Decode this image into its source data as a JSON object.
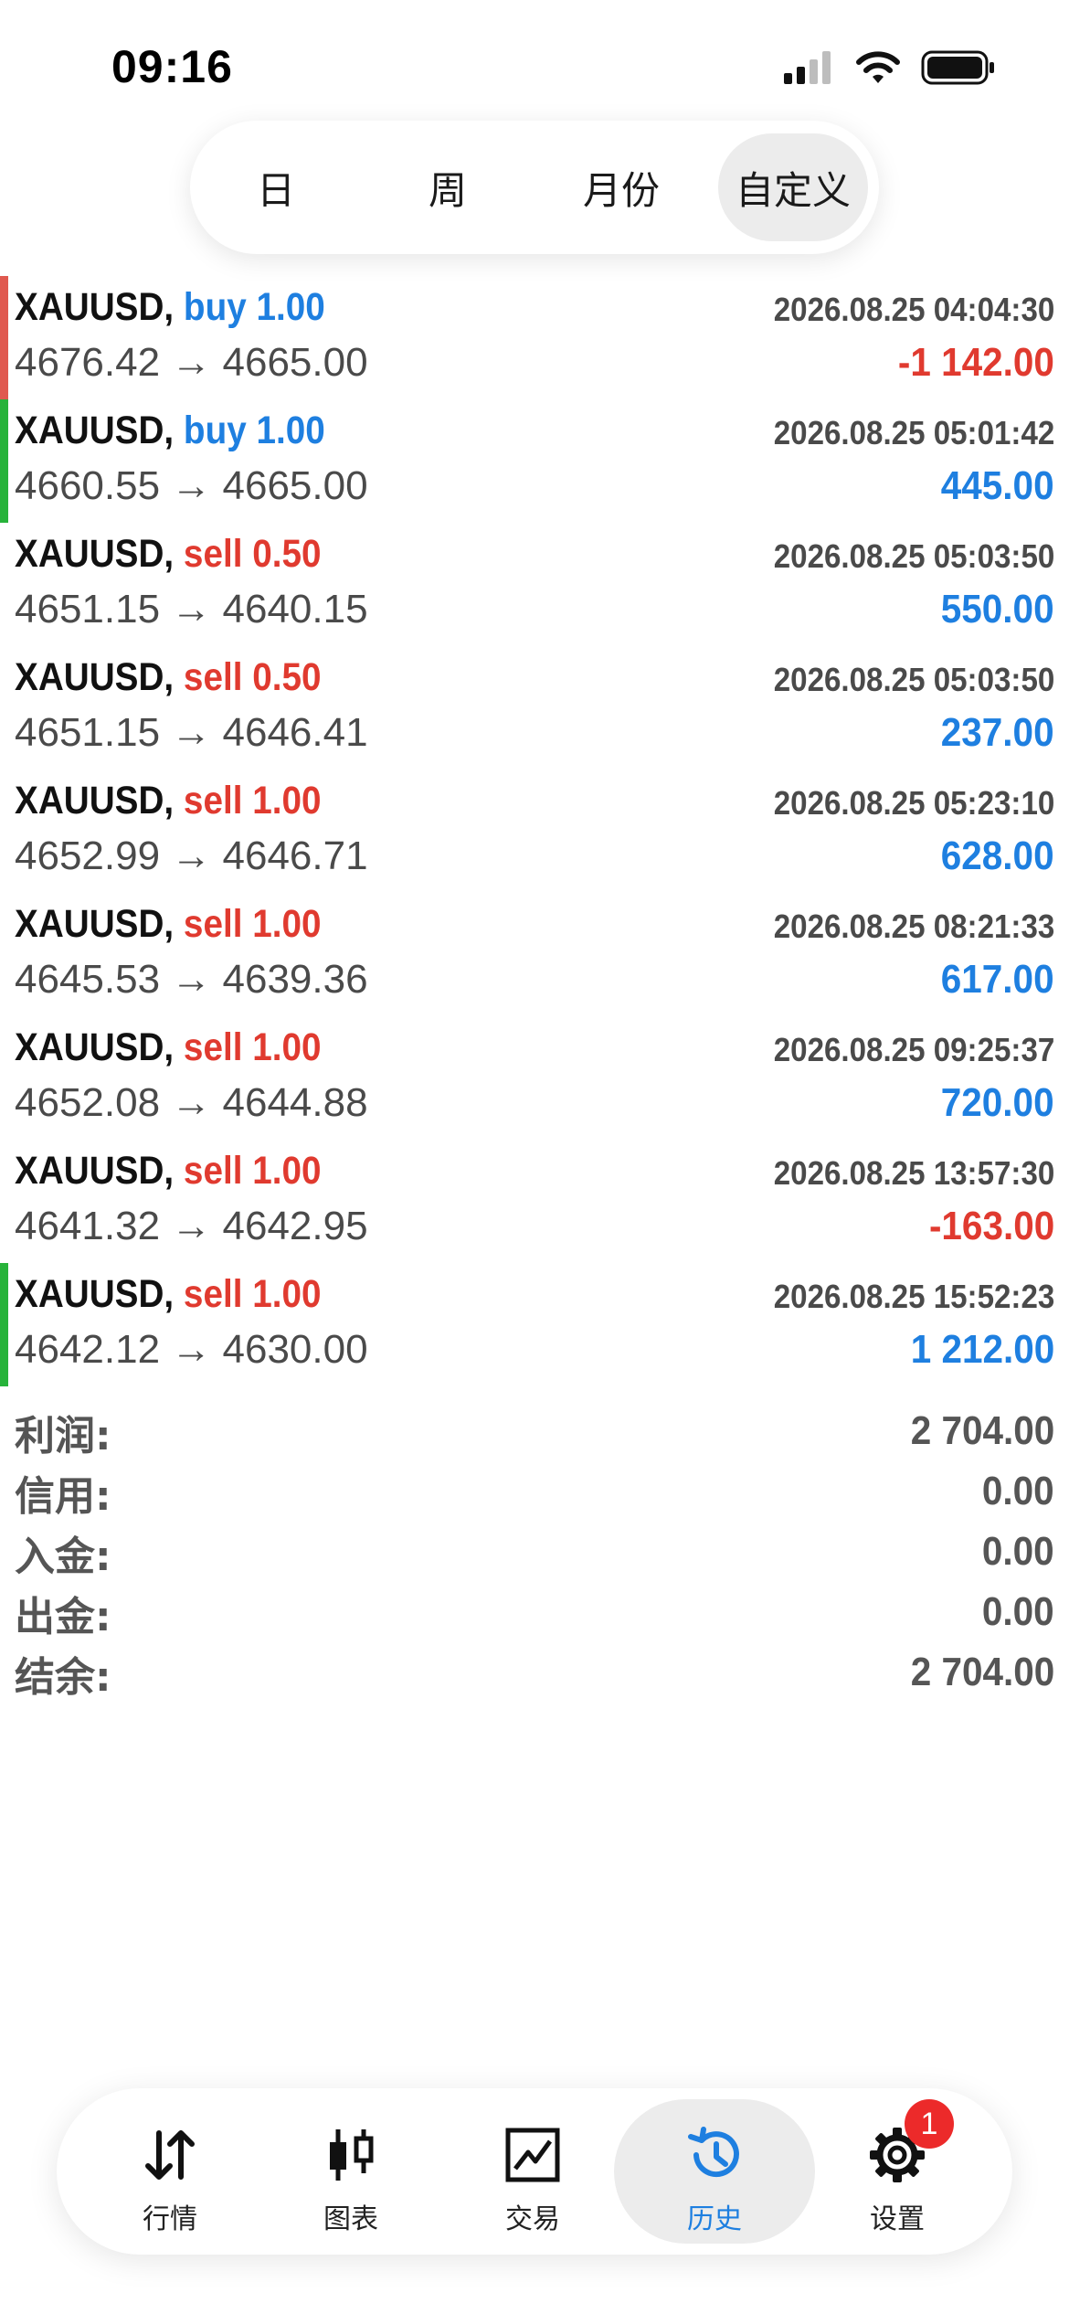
{
  "status_bar": {
    "time": "09:16",
    "icons": [
      "cellular-signal-icon",
      "wifi-icon",
      "battery-icon"
    ]
  },
  "period_tabs": [
    {
      "label": "日",
      "active": false
    },
    {
      "label": "周",
      "active": false
    },
    {
      "label": "月份",
      "active": false
    },
    {
      "label": "自定义",
      "active": true
    }
  ],
  "trades": [
    {
      "symbol": "XAUUSD,",
      "side": "buy 1.00",
      "type": "buy",
      "time": "2026.08.25 04:04:30",
      "prices": "4676.42 → 4665.00",
      "profit": "-1 142.00",
      "accent": "#e0594f"
    },
    {
      "symbol": "XAUUSD,",
      "side": "buy 1.00",
      "type": "buy",
      "time": "2026.08.25 05:01:42",
      "prices": "4660.55 → 4665.00",
      "profit": "445.00",
      "accent": "#27b33a"
    },
    {
      "symbol": "XAUUSD,",
      "side": "sell 0.50",
      "type": "sell",
      "time": "2026.08.25 05:03:50",
      "prices": "4651.15 → 4640.15",
      "profit": "550.00",
      "accent": ""
    },
    {
      "symbol": "XAUUSD,",
      "side": "sell 0.50",
      "type": "sell",
      "time": "2026.08.25 05:03:50",
      "prices": "4651.15 → 4646.41",
      "profit": "237.00",
      "accent": ""
    },
    {
      "symbol": "XAUUSD,",
      "side": "sell 1.00",
      "type": "sell",
      "time": "2026.08.25 05:23:10",
      "prices": "4652.99 → 4646.71",
      "profit": "628.00",
      "accent": ""
    },
    {
      "symbol": "XAUUSD,",
      "side": "sell 1.00",
      "type": "sell",
      "time": "2026.08.25 08:21:33",
      "prices": "4645.53 → 4639.36",
      "profit": "617.00",
      "accent": ""
    },
    {
      "symbol": "XAUUSD,",
      "side": "sell 1.00",
      "type": "sell",
      "time": "2026.08.25 09:25:37",
      "prices": "4652.08 → 4644.88",
      "profit": "720.00",
      "accent": ""
    },
    {
      "symbol": "XAUUSD,",
      "side": "sell 1.00",
      "type": "sell",
      "time": "2026.08.25 13:57:30",
      "prices": "4641.32 → 4642.95",
      "profit": "-163.00",
      "accent": ""
    },
    {
      "symbol": "XAUUSD,",
      "side": "sell 1.00",
      "type": "sell",
      "time": "2026.08.25 15:52:23",
      "prices": "4642.12 → 4630.00",
      "profit": "1 212.00",
      "accent": "#27b33a"
    }
  ],
  "summary": [
    {
      "label": "利润:",
      "value": "2 704.00"
    },
    {
      "label": "信用:",
      "value": "0.00"
    },
    {
      "label": "入金:",
      "value": "0.00"
    },
    {
      "label": "出金:",
      "value": "0.00"
    },
    {
      "label": "结余:",
      "value": "2 704.00"
    }
  ],
  "bottom_nav": [
    {
      "label": "行情",
      "icon": "quotes-arrows-icon",
      "active": false
    },
    {
      "label": "图表",
      "icon": "candlestick-chart-icon",
      "active": false
    },
    {
      "label": "交易",
      "icon": "trade-chart-icon",
      "active": false
    },
    {
      "label": "历史",
      "icon": "history-clock-icon",
      "active": true
    },
    {
      "label": "设置",
      "icon": "settings-gear-icon",
      "active": false,
      "badge": "1"
    }
  ],
  "colors": {
    "buy": "#1e7fe0",
    "sell": "#e03a2f",
    "profit_positive": "#1e7fe0",
    "profit_negative": "#e03a2f",
    "active_nav": "#1e7fe0"
  }
}
